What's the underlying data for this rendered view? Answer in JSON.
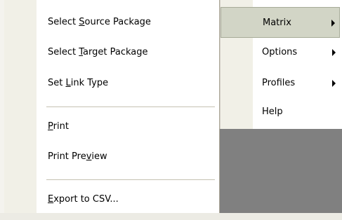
{
  "main_menu": {
    "items": [
      {
        "pre": "Select ",
        "key": "S",
        "post": "ource Package"
      },
      {
        "pre": "Select ",
        "key": "T",
        "post": "arget Package"
      },
      {
        "pre": "Set ",
        "key": "L",
        "post": "ink Type"
      },
      {
        "pre": "",
        "key": "P",
        "post": "rint"
      },
      {
        "pre": "Print Pre",
        "key": "v",
        "post": "iew"
      },
      {
        "pre": "",
        "key": "E",
        "post": "xport to CSV..."
      }
    ]
  },
  "sub_menu": {
    "items": [
      {
        "label": "Matrix",
        "has_submenu": true,
        "selected": true
      },
      {
        "label": "Options",
        "has_submenu": true,
        "selected": false
      },
      {
        "label": "Profiles",
        "has_submenu": true,
        "selected": false
      },
      {
        "label": "Help",
        "has_submenu": false,
        "selected": false
      }
    ]
  },
  "colors": {
    "menu_bg": "#ffffff",
    "gutter": "#f1f0e7",
    "selected_bg": "#d2d5c6",
    "background": "#808080"
  }
}
